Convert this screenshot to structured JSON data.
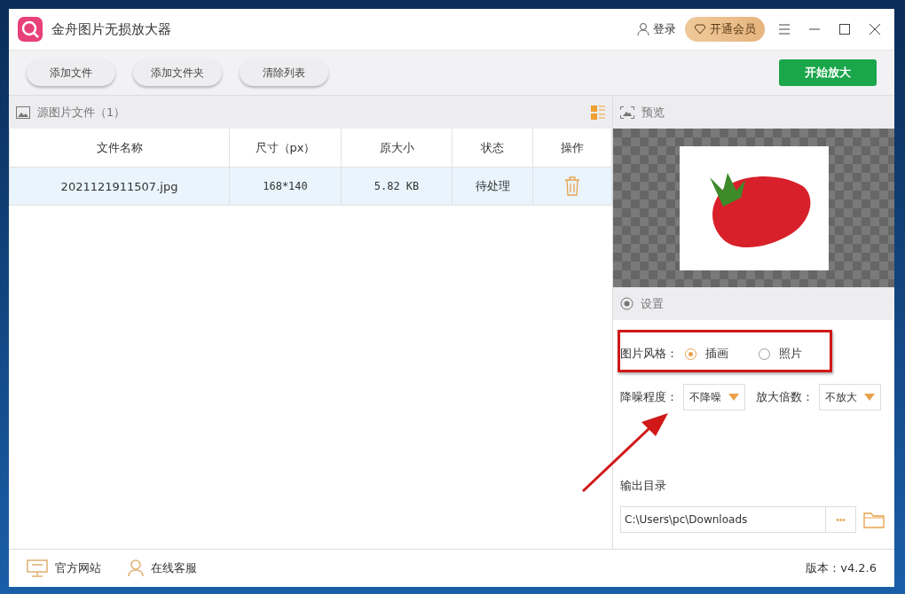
{
  "window": {
    "title": "金舟图片无损放大器",
    "login": "登录",
    "vip": "开通会员"
  },
  "toolbar": {
    "buttons": [
      "添加文件",
      "添加文件夹",
      "清除列表"
    ],
    "primary": "开始放大"
  },
  "files": {
    "title": "源图片文件（1）",
    "columns": [
      "文件名称",
      "尺寸（px）",
      "原大小",
      "状态",
      "操作"
    ],
    "rows": [
      {
        "name": "2021121911507.jpg",
        "size": "168*140",
        "bytes": "5.82 KB",
        "status": "待处理",
        "selected": true
      }
    ]
  },
  "preview": {
    "title": "预览"
  },
  "settings": {
    "title": "设置",
    "style_label": "图片风格：",
    "styles": [
      {
        "label": "插画",
        "selected": true
      },
      {
        "label": "照片",
        "selected": false
      }
    ],
    "denoise_label": "降噪程度：",
    "denoise": "不降噪",
    "scale_label": "放大倍数：",
    "scale": "不放大",
    "output_label": "输出目录",
    "output_path": "C:\\Users\\pc\\Downloads",
    "browse": "•••"
  },
  "footer": {
    "links": [
      "官方网站",
      "在线客服"
    ],
    "version": "版本：v4.2.6"
  }
}
